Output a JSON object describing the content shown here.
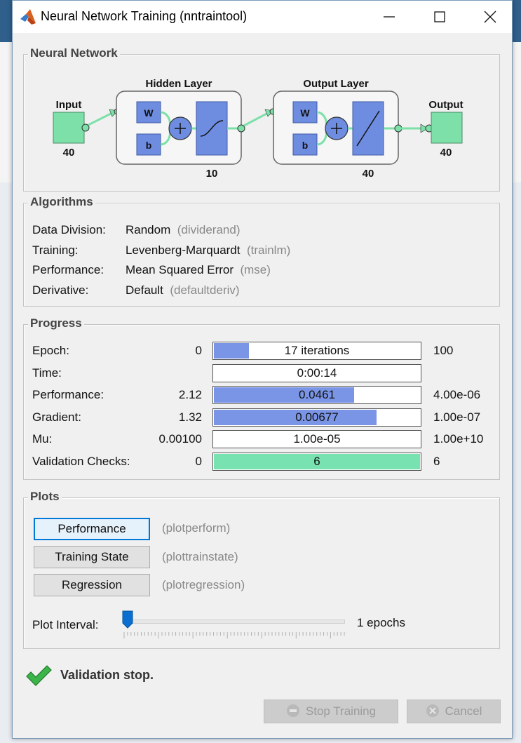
{
  "window": {
    "title": "Neural Network Training (nntraintool)"
  },
  "network": {
    "group_title": "Neural Network",
    "input_label": "Input",
    "input_size": "40",
    "hidden_label": "Hidden Layer",
    "hidden_size": "10",
    "output_layer_label": "Output Layer",
    "output_layer_size": "40",
    "output_label": "Output",
    "output_size": "40",
    "weight_label": "W",
    "bias_label": "b",
    "colors": {
      "node": "#7ce0a8",
      "block": "#6f8de0",
      "connector": "#7ce0a8"
    }
  },
  "algorithms": {
    "group_title": "Algorithms",
    "rows": [
      {
        "label": "Data Division:",
        "value": "Random",
        "hint": "(dividerand)"
      },
      {
        "label": "Training:",
        "value": "Levenberg-Marquardt",
        "hint": "(trainlm)"
      },
      {
        "label": "Performance:",
        "value": "Mean Squared Error",
        "hint": "(mse)"
      },
      {
        "label": "Derivative:",
        "value": "Default",
        "hint": "(defaultderiv)"
      }
    ]
  },
  "progress": {
    "group_title": "Progress",
    "rows": [
      {
        "label": "Epoch:",
        "start": "0",
        "value": "17 iterations",
        "end": "100",
        "fill": 0.17,
        "color": "#7a95e6"
      },
      {
        "label": "Time:",
        "start": "",
        "value": "0:00:14",
        "end": "",
        "fill": 0,
        "color": "#7a95e6"
      },
      {
        "label": "Performance:",
        "start": "2.12",
        "value": "0.0461",
        "end": "4.00e-06",
        "fill": 0.68,
        "color": "#7a95e6"
      },
      {
        "label": "Gradient:",
        "start": "1.32",
        "value": "0.00677",
        "end": "1.00e-07",
        "fill": 0.79,
        "color": "#7a95e6"
      },
      {
        "label": "Mu:",
        "start": "0.00100",
        "value": "1.00e-05",
        "end": "1.00e+10",
        "fill": 0,
        "color": "#7a95e6"
      },
      {
        "label": "Validation Checks:",
        "start": "0",
        "value": "6",
        "end": "6",
        "fill": 1.0,
        "color": "#78e2b0"
      }
    ]
  },
  "plots": {
    "group_title": "Plots",
    "buttons": [
      {
        "label": "Performance",
        "hint": "(plotperform)"
      },
      {
        "label": "Training State",
        "hint": "(plottrainstate)"
      },
      {
        "label": "Regression",
        "hint": "(plotregression)"
      }
    ],
    "interval_label": "Plot Interval:",
    "interval_value": "1 epochs",
    "interval_fraction": 0.0
  },
  "status": {
    "icon": "checkmark-icon",
    "text": "Validation stop."
  },
  "footer": {
    "stop_label": "Stop Training",
    "cancel_label": "Cancel"
  }
}
